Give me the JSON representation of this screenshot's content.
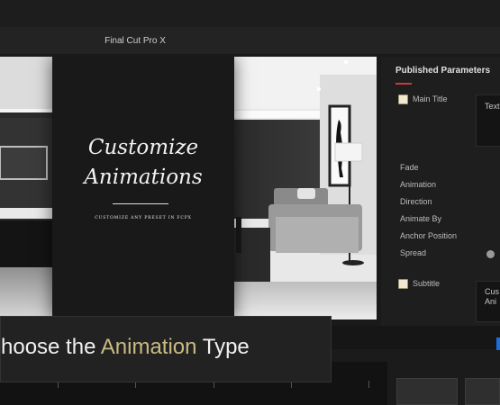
{
  "window": {
    "title": "Final Cut Pro X"
  },
  "viewer": {
    "title_line1": "Customize",
    "title_line2": "Animations",
    "tagline": "CUSTOMIZE ANY PRESET IN FCPX"
  },
  "inspector": {
    "header": "Published Parameters",
    "main_title": {
      "label": "Main Title",
      "field_text": "Text"
    },
    "params": [
      "Fade",
      "Animation",
      "Direction",
      "Animate By",
      "Anchor Position",
      "Spread"
    ],
    "subtitle": {
      "label": "Subtitle",
      "field_text_line1": "Cus",
      "field_text_line2": "Ani"
    }
  },
  "caption": {
    "prefix": "hoose the ",
    "highlight": "Animation",
    "suffix": " Type"
  },
  "colors": {
    "accent": "#c9bb83",
    "inspector_accent": "#c83b3b",
    "selection": "#1c6fd8"
  }
}
